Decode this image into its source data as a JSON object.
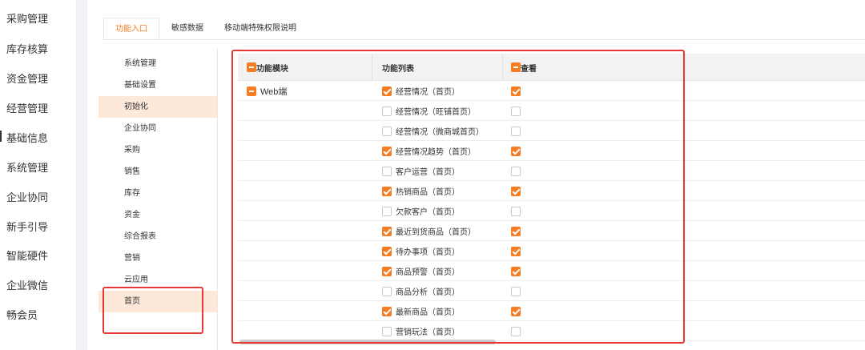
{
  "main_nav": {
    "items": [
      "采购管理",
      "库存核算",
      "资金管理",
      "经营管理",
      "基础信息",
      "系统管理",
      "企业协同",
      "新手引导",
      "智能硬件",
      "企业微信",
      "畅会员"
    ],
    "active_index": 4
  },
  "tabs": [
    "功能入口",
    "敏感数据",
    "移动端特殊权限说明"
  ],
  "active_tab": 0,
  "submenu": {
    "items": [
      "系统管理",
      "基础设置",
      "初始化",
      "企业协同",
      "采购",
      "销售",
      "库存",
      "资金",
      "综合报表",
      "营销",
      "云应用",
      "首页"
    ],
    "highlighted": [
      2,
      11
    ]
  },
  "table": {
    "headers": [
      "功能模块",
      "功能列表",
      "查看"
    ],
    "module_label": "Web端",
    "rows": [
      {
        "name": "经营情况（首页）",
        "checked": true,
        "view": true
      },
      {
        "name": "经营情况（旺铺首页）",
        "checked": false,
        "view": false
      },
      {
        "name": "经营情况（微商城首页）",
        "checked": false,
        "view": false
      },
      {
        "name": "经营情况趋势（首页）",
        "checked": true,
        "view": true
      },
      {
        "name": "客户运营（首页）",
        "checked": false,
        "view": false
      },
      {
        "name": "热销商品（首页）",
        "checked": true,
        "view": true
      },
      {
        "name": "欠款客户（首页）",
        "checked": false,
        "view": false
      },
      {
        "name": "最近到货商品（首页）",
        "checked": true,
        "view": true
      },
      {
        "name": "待办事项（首页）",
        "checked": true,
        "view": true
      },
      {
        "name": "商品预警（首页）",
        "checked": true,
        "view": true
      },
      {
        "name": "商品分析（首页）",
        "checked": false,
        "view": false
      },
      {
        "name": "最新商品（首页）",
        "checked": true,
        "view": true
      },
      {
        "name": "营销玩法（首页）",
        "checked": false,
        "view": false
      }
    ]
  },
  "colors": {
    "accent": "#f57c20",
    "highlight_bg": "#fde8d9",
    "annotation_red": "#e53935"
  }
}
